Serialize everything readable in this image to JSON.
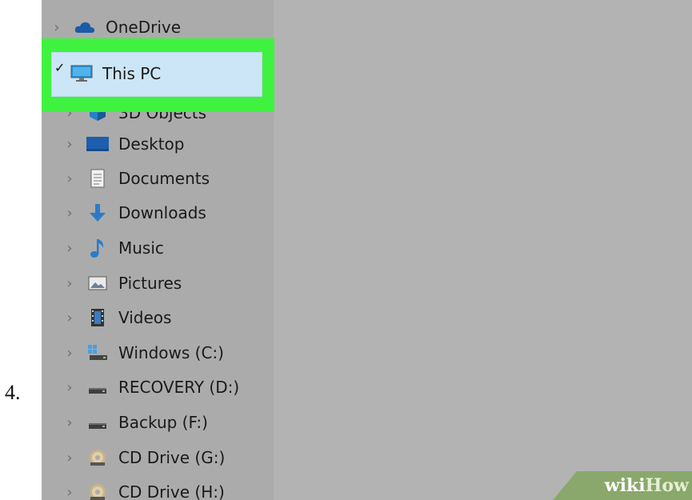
{
  "step_number": "4.",
  "nav": {
    "onedrive": "OneDrive",
    "this_pc": "This PC",
    "objects3d": "3D Objects",
    "desktop": "Desktop",
    "documents": "Documents",
    "downloads": "Downloads",
    "music": "Music",
    "pictures": "Pictures",
    "videos": "Videos",
    "windows_c": "Windows (C:)",
    "recovery_d": "RECOVERY (D:)",
    "backup_f": "Backup (F:)",
    "cd_g": "CD Drive (G:)",
    "cd_h": "CD Drive (H:)"
  },
  "watermark": {
    "wiki": "wiki",
    "how": "How"
  },
  "colors": {
    "highlight": "#3ff23f",
    "selection": "#cce6f7",
    "pane": "#ababab"
  }
}
